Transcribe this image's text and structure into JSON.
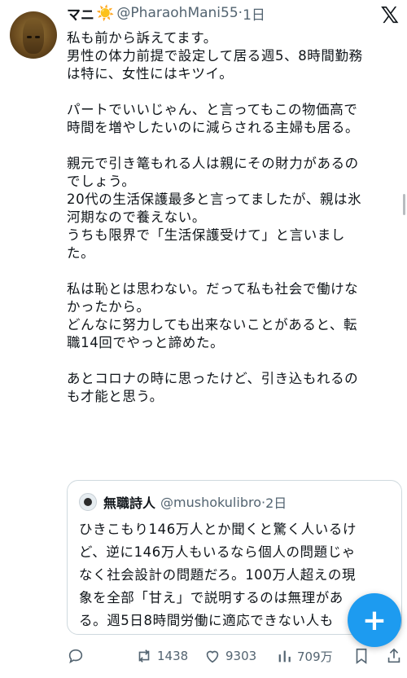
{
  "author": {
    "name": "マニ",
    "badge": "☀️",
    "handle": "@PharaohMani55",
    "separator": "·",
    "time": "1日"
  },
  "post_lines": [
    "私も前から訴えてます。",
    "男性の体力前提で設定して居る週5、8時間勤務",
    "は特に、女性にはキツイ。",
    "",
    "パートでいいじゃん、と言ってもこの物価高で",
    "時間を増やしたいのに減らされる主婦も居る。",
    "",
    "親元で引き篭もれる人は親にその財力があるの",
    "でしょう。",
    "20代の生活保護最多と言ってましたが、親は氷",
    "河期なので養えない。",
    "うちも限界で「生活保護受けて」と言いまし",
    "た。",
    "",
    "私は恥とは思わない。だって私も社会で働けな",
    "かったから。",
    "どんなに努力しても出来ないことがあると、転",
    "職14回でやっと諦めた。",
    "",
    "あとコロナの時に思ったけど、引き込もれるの",
    "も才能と思う。"
  ],
  "quote": {
    "name": "無職詩人",
    "handle": "@mushokulibro",
    "separator": "·",
    "time": "2日",
    "lines": [
      "ひきこもり146万人とか聞くと驚く人いるけ",
      "ど、逆に146万人もいるなら個人の問題じゃ",
      "なく社会設計の問題だろ。100万人超えの現",
      "象を全部「甘え」で説明するのは無理があ",
      "る。週5日8時間労働に適応できない人も"
    ]
  },
  "actions": {
    "retweets": "1438",
    "likes": "9303",
    "views": "709万"
  },
  "icons": {
    "logo": "x-logo-icon",
    "compose": "plus-icon"
  },
  "colors": {
    "accent": "#1d9bf0",
    "secondary_text": "#536471",
    "border": "#cfd9de"
  }
}
